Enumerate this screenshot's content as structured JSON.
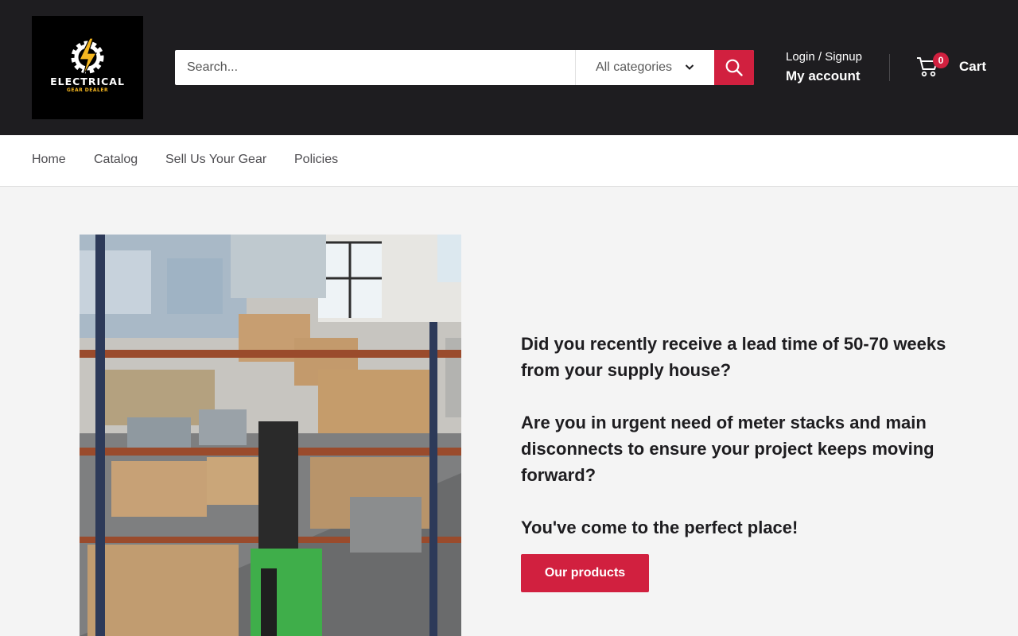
{
  "brand": {
    "logo_line1": "ELECTRICAL",
    "logo_line2": "GEAR DEALER",
    "logo_icon": "lightning-gear-icon",
    "accent_color": "#d1203f",
    "header_bg": "#1e1d20"
  },
  "search": {
    "placeholder": "Search...",
    "category_selected": "All categories",
    "button_icon": "search-icon"
  },
  "account": {
    "login_label": "Login / Signup",
    "account_label": "My account"
  },
  "cart": {
    "count": "0",
    "label": "Cart",
    "icon": "cart-icon"
  },
  "nav": {
    "items": [
      {
        "label": "Home"
      },
      {
        "label": "Catalog"
      },
      {
        "label": "Sell Us Your Gear"
      },
      {
        "label": "Policies"
      }
    ]
  },
  "hero": {
    "image": "warehouse-photo",
    "paragraphs": [
      "Did you recently receive a lead time of 50-70 weeks from your supply house?",
      "Are you in urgent need of meter stacks and main disconnects to ensure your project keeps moving forward?",
      "You've come to the perfect place!"
    ],
    "cta_label": "Our products"
  }
}
